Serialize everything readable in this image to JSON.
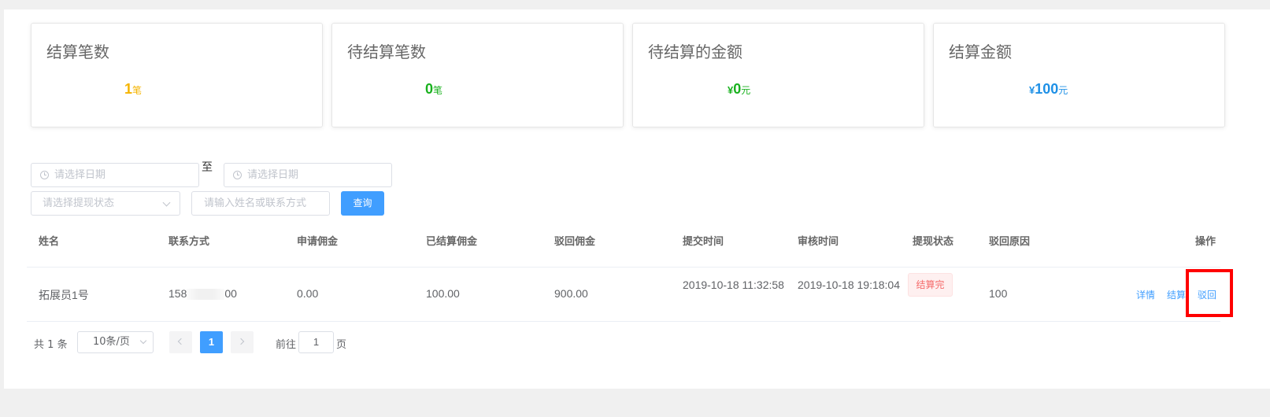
{
  "cards": [
    {
      "title": "结算笔数",
      "value": "1",
      "unit": "笔",
      "currency": "",
      "color": "#f5b400"
    },
    {
      "title": "待结算笔数",
      "value": "0",
      "unit": "笔",
      "currency": "",
      "color": "#19b11e"
    },
    {
      "title": "待结算的金额",
      "value": "0",
      "unit": "元",
      "currency": "¥",
      "color": "#19b11e"
    },
    {
      "title": "结算金额",
      "value": "100",
      "unit": "元",
      "currency": "¥",
      "color": "#1e90e6"
    }
  ],
  "filters": {
    "start_date_placeholder": "请选择日期",
    "separator": "至",
    "end_date_placeholder": "请选择日期",
    "status_placeholder": "请选择提现状态",
    "keyword_placeholder": "请输入姓名或联系方式",
    "query_label": "查询"
  },
  "table": {
    "headers": [
      "姓名",
      "联系方式",
      "申请佣金",
      "已结算佣金",
      "驳回佣金",
      "提交时间",
      "审核时间",
      "提现状态",
      "驳回原因",
      "操作"
    ],
    "rows": [
      {
        "name": "拓展员1号",
        "phone_prefix": "158",
        "phone_suffix": "00",
        "applied": "0.00",
        "settled": "100.00",
        "rejected": "900.00",
        "submit_time": "2019-10-18 11:32:58",
        "review_time": "2019-10-18 19:18:04",
        "status": "结算完",
        "reason": "100",
        "actions": {
          "detail": "详情",
          "settle": "结算",
          "reject": "驳回"
        }
      }
    ]
  },
  "pagination": {
    "total_prefix": "共",
    "total": "1",
    "total_suffix": "条",
    "page_size": "10条/页",
    "current_page": "1",
    "goto_label": "前往",
    "goto_value": "1",
    "page_suffix": "页"
  },
  "colors": {
    "primary": "#409eff",
    "highlight_box": "#ff0000"
  }
}
